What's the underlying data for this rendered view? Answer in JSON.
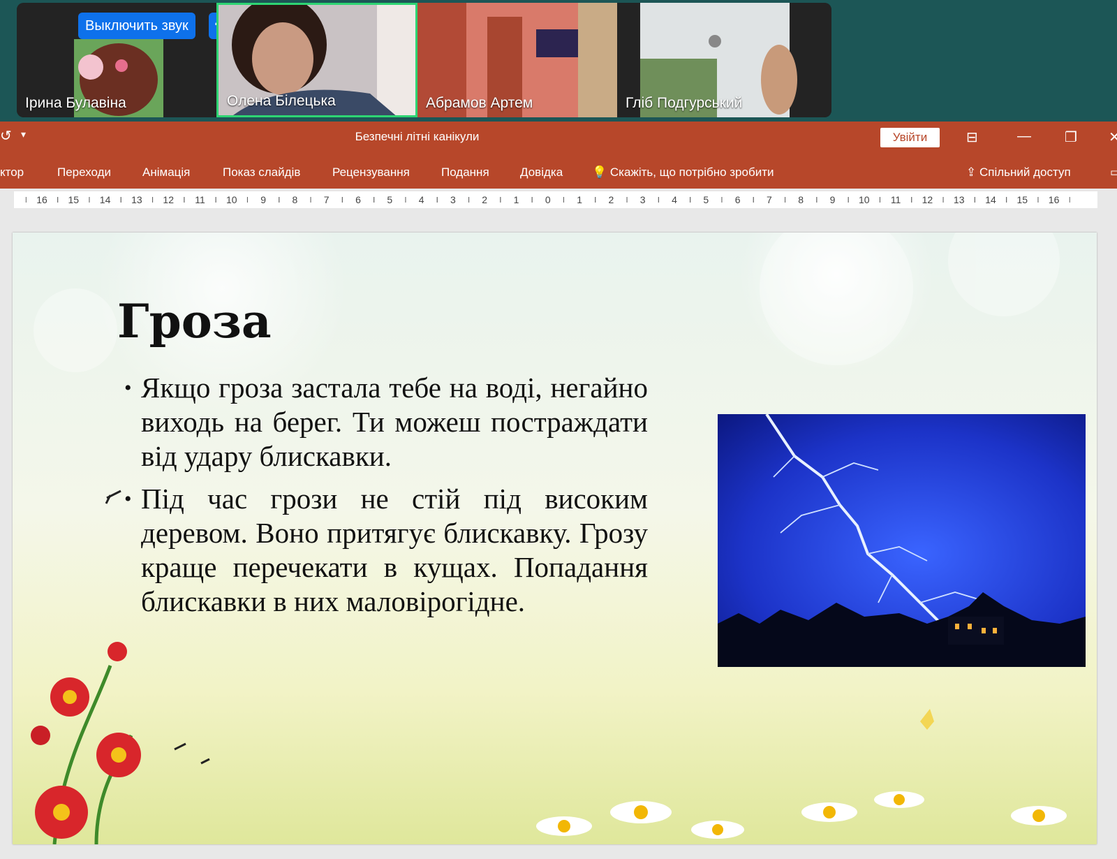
{
  "zoom": {
    "mute_label": "Выключить звук",
    "more_label": "···",
    "participants": [
      {
        "name": "Ірина Булавіна"
      },
      {
        "name": "Олена Білецька",
        "active": true
      },
      {
        "name": "Абрамов Артем"
      },
      {
        "name": "Гліб Подгурський"
      }
    ]
  },
  "app": {
    "title": "Безпечні літні канікули",
    "signin_label": "Увійти",
    "tabs": [
      "ктор",
      "Переходи",
      "Анімація",
      "Показ слайдів",
      "Рецензування",
      "Подання",
      "Довідка"
    ],
    "tell_me": "Скажіть, що потрібно зробити",
    "share_label": "Спільний доступ",
    "ruler_labels": [
      "16",
      "15",
      "14",
      "13",
      "12",
      "11",
      "10",
      "9",
      "8",
      "7",
      "6",
      "5",
      "4",
      "3",
      "2",
      "1",
      "0",
      "1",
      "2",
      "3",
      "4",
      "5",
      "6",
      "7",
      "8",
      "9",
      "10",
      "11",
      "12",
      "13",
      "14",
      "15",
      "16"
    ]
  },
  "slide": {
    "title": "Гроза",
    "bullets": [
      "Якщо гроза застала тебе на воді, негайно виходь на берег. Ти можеш постраждати від удару блискавки.",
      "Під час грози не стій під високим деревом. Воно притягує блискавку. Грозу краще перечекати в кущах. Попадання блискавки в них маловірогідне."
    ]
  },
  "colors": {
    "accent_ppt": "#b7472a",
    "zoom_bg": "#1c5656",
    "zoom_blue": "#0e71eb",
    "active_speaker": "#2ed573"
  }
}
